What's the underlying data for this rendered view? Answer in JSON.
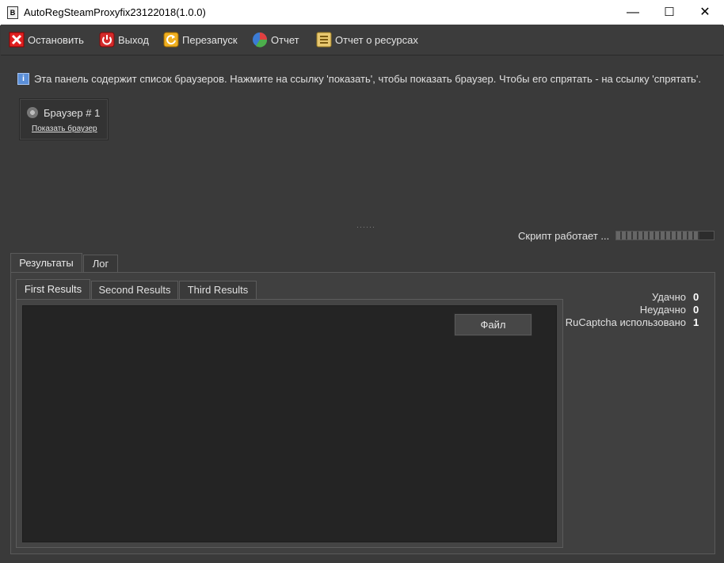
{
  "window": {
    "title": "AutoRegSteamProxyfix23122018(1.0.0)",
    "minimize": "—",
    "maximize": "☐",
    "close": "✕"
  },
  "toolbar": {
    "stop": "Остановить",
    "exit": "Выход",
    "restart": "Перезапуск",
    "report": "Отчет",
    "resource_report": "Отчет о ресурсах"
  },
  "info": {
    "text": "Эта панель содержит список браузеров. Нажмите на ссылку 'показать', чтобы показать браузер. Чтобы его спрятать - на ссылку 'спрятать'."
  },
  "browsers": [
    {
      "name": "Браузер # 1",
      "link": "Показать браузер"
    }
  ],
  "status": {
    "text": "Скрипт работает ...",
    "progress": 0.85
  },
  "tabs": [
    {
      "label": "Результаты",
      "active": true
    },
    {
      "label": "Лог",
      "active": false
    }
  ],
  "subtabs": [
    {
      "label": "First Results",
      "active": true
    },
    {
      "label": "Second Results",
      "active": false
    },
    {
      "label": "Third Results",
      "active": false
    }
  ],
  "results": {
    "file_button": "Файл"
  },
  "stats": [
    {
      "label": "Удачно",
      "value": "0"
    },
    {
      "label": "Неудачно",
      "value": "0"
    },
    {
      "label": "RuCaptcha использовано",
      "value": "1"
    }
  ],
  "colors": {
    "background": "#3a3a3a",
    "results_area": "#242424",
    "titlebar": "#ffffff"
  }
}
